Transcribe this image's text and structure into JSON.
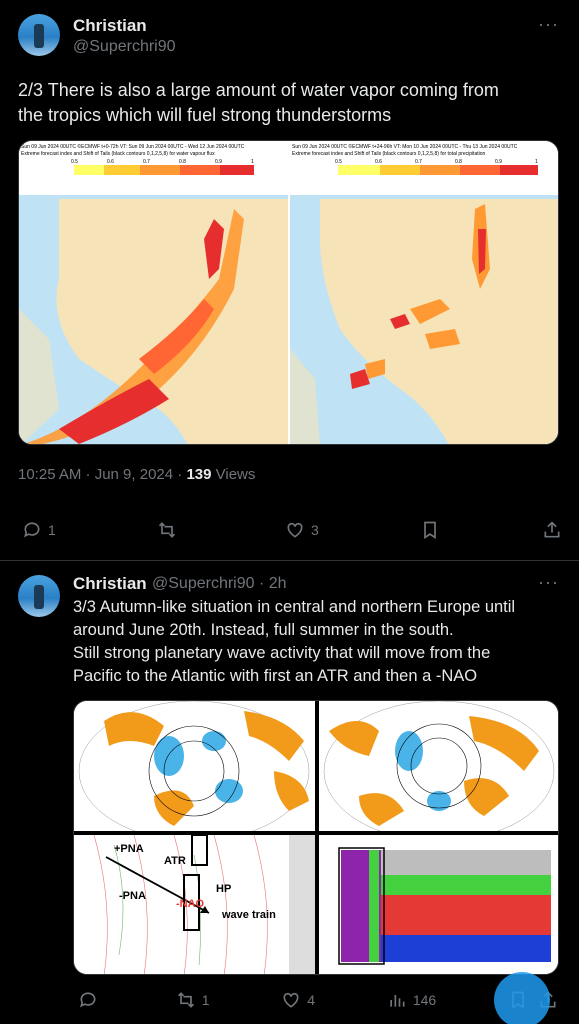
{
  "tweet1": {
    "name": "Christian",
    "handle": "@Superchri90",
    "text_line1": "2/3 There is also a large amount of water vapor coming from",
    "text_line2": "the tropics which will fuel strong thunderstorms",
    "map_left_caption": "Sun 09 Jun 2024 00UTC ©ECMWF t+0-72h  VT: Sun 09 Jun 2024 00UTC - Wed 12 Jun 2024 00UTC",
    "map_left_sub": "Extreme forecast index and Shift of Tails (black contours 0,1,2,5,8) for water vapour flux",
    "map_right_caption": "Sun 09 Jun 2024 00UTC ©ECMWF t+24-96h  VT: Mon 10 Jun 2024 00UTC - Thu 13 Jun 2024 00UTC",
    "map_right_sub": "Extreme forecast index and Shift of Tails (black contours 0,1,2,5,8) for total precipitation",
    "scale_labels": [
      "0.5",
      "0.6",
      "0.7",
      "0.8",
      "0.9",
      "1"
    ],
    "time": "10:25 AM · Jun 9, 2024 · ",
    "views_count": "139",
    "views_label": " Views",
    "replies": "1",
    "retweets": "",
    "likes": "3"
  },
  "tweet2": {
    "name": "Christian",
    "handle": "@Superchri90 · 2h",
    "line1": "3/3 Autumn-like situation in central and northern Europe until",
    "line2": "around June 20th. Instead, full summer in the south.",
    "line3": "Still strong planetary wave activity that will move from the",
    "line4": "Pacific to the Atlantic with first an ATR and then a -NAO",
    "labels": {
      "pna_plus": "+PNA",
      "pna_minus": "-PNA",
      "atr": "ATR",
      "nao": "-NAO",
      "hp": "HP",
      "wave_train": "wave train"
    },
    "replies": "",
    "retweets": "1",
    "likes": "4",
    "views": "146"
  },
  "colors": {
    "background": "#000000",
    "text": "#e7e9ea",
    "muted": "#71767b",
    "accent": "#1d9bf0"
  }
}
